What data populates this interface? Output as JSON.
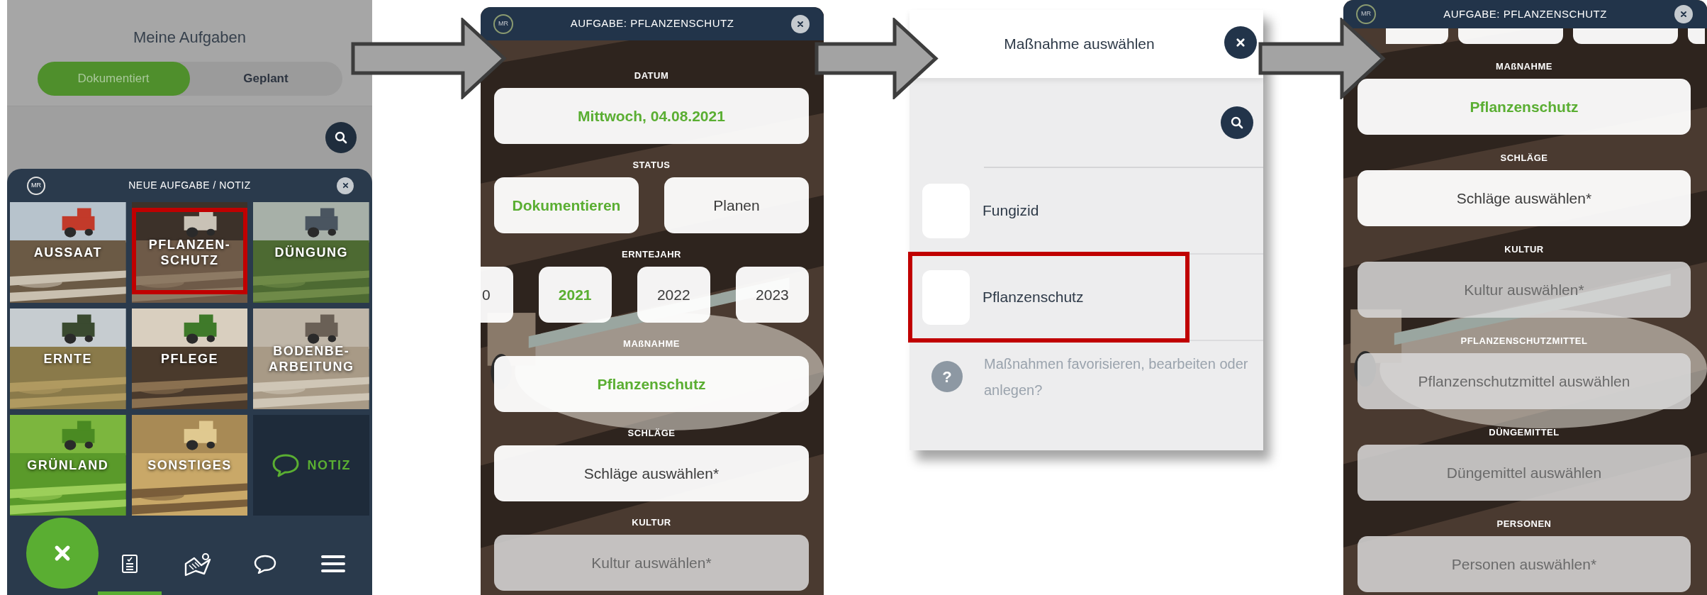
{
  "task_list_screen": {
    "title": "Meine Aufgaben",
    "tabs": [
      {
        "label": "Dokumentiert",
        "selected": true
      },
      {
        "label": "Geplant",
        "selected": false
      }
    ],
    "sheet": {
      "logo": "MR",
      "title": "NEUE AUFGABE / NOTIZ",
      "tiles": [
        {
          "label": "AUSSAAT",
          "highlighted": false
        },
        {
          "label": "PFLANZEN-SCHUTZ",
          "highlighted": true
        },
        {
          "label": "DÜNGUNG",
          "highlighted": false
        },
        {
          "label": "ERNTE",
          "highlighted": false
        },
        {
          "label": "PFLEGE",
          "highlighted": false
        },
        {
          "label": "BODENBE-ARBEITUNG",
          "highlighted": false
        },
        {
          "label": "GRÜNLAND",
          "highlighted": false
        },
        {
          "label": "SONSTIGES",
          "highlighted": false
        },
        {
          "kind": "note",
          "label": "NOTIZ",
          "highlighted": false
        }
      ]
    },
    "nav_items": [
      {
        "kind": "tasks",
        "selected": true
      },
      {
        "kind": "map",
        "selected": false
      },
      {
        "kind": "chat",
        "selected": false
      },
      {
        "kind": "menu",
        "selected": false
      }
    ]
  },
  "task_form_screen": {
    "logo": "MR",
    "title": "AUFGABE: PFLANZENSCHUTZ",
    "fields": [
      {
        "kind": "select",
        "label": "DATUM",
        "text": "Mittwoch, 04.08.2021",
        "chosen": true,
        "disabled": false
      },
      {
        "kind": "choice",
        "label": "STATUS",
        "options": [
          {
            "text": "Dokumentieren",
            "selected": true
          },
          {
            "text": "Planen",
            "selected": false
          }
        ]
      },
      {
        "kind": "carousel",
        "label": "ERNTEJAHR",
        "options": [
          {
            "text": "0",
            "selected": false,
            "cut": true
          },
          {
            "text": "2021",
            "selected": true,
            "cut": false
          },
          {
            "text": "2022",
            "selected": false,
            "cut": false
          },
          {
            "text": "2023",
            "selected": false,
            "cut": false
          }
        ]
      },
      {
        "kind": "select",
        "label": "MAßNAHME",
        "text": "Pflanzenschutz",
        "chosen": true,
        "disabled": false
      },
      {
        "kind": "select",
        "label": "SCHLÄGE",
        "text": "Schläge auswählen*",
        "chosen": false,
        "disabled": false
      },
      {
        "kind": "select",
        "label": "KULTUR",
        "text": "Kultur auswählen*",
        "chosen": false,
        "disabled": true
      }
    ]
  },
  "measure_picker": {
    "title": "Maßnahme auswählen",
    "items": [
      {
        "text": "Fungizid",
        "highlighted": false
      },
      {
        "text": "Pflanzenschutz",
        "highlighted": true
      }
    ],
    "help_icon": "?",
    "help_text": "Maßnahmen favorisieren, bearbeiten oder anlegen?"
  },
  "task_form_scrolled": {
    "logo": "MR",
    "title": "AUFGABE: PFLANZENSCHUTZ",
    "fields": [
      {
        "kind": "select",
        "label": "MAßNAHME",
        "text": "Pflanzenschutz",
        "chosen": true,
        "disabled": false
      },
      {
        "kind": "select",
        "label": "SCHLÄGE",
        "text": "Schläge auswählen*",
        "chosen": false,
        "disabled": false
      },
      {
        "kind": "select",
        "label": "KULTUR",
        "text": "Kultur auswählen*",
        "chosen": false,
        "disabled": true
      },
      {
        "kind": "select",
        "label": "PFLANZENSCHUTZMITTEL",
        "text": "Pflanzenschutzmittel auswählen",
        "chosen": false,
        "disabled": true
      },
      {
        "kind": "select",
        "label": "DÜNGEMITTEL",
        "text": "Düngemittel auswählen",
        "chosen": false,
        "disabled": true
      },
      {
        "kind": "select",
        "label": "PERSONEN",
        "text": "Personen auswählen*",
        "chosen": false,
        "disabled": true
      }
    ]
  }
}
